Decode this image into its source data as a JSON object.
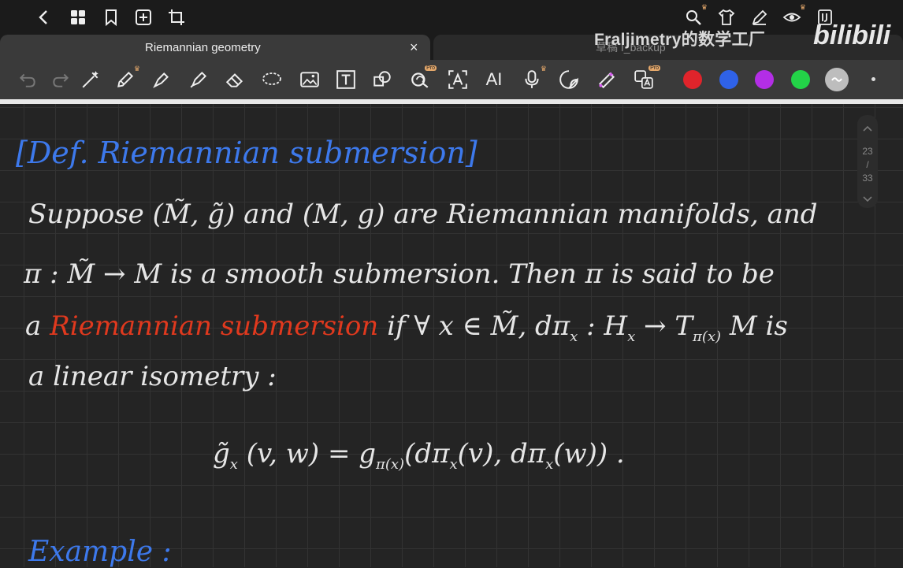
{
  "tabs": {
    "active_title": "Riemannian geometry",
    "close_glyph": "×",
    "inactive_title": "草稿 I_backup"
  },
  "watermark": {
    "text": "Fraljimetry的数学工厂",
    "brand": "bilibili"
  },
  "toolbar": {
    "ai_label": "AI",
    "pro_badge": "Pro",
    "colors": [
      "#e0242b",
      "#2f62e8",
      "#b32ee6",
      "#23d348",
      "#bdbdbd"
    ]
  },
  "page_indicator": {
    "current": "23",
    "separator": "/",
    "total": "33"
  },
  "note": {
    "heading": "[Def. Riemannian submersion]",
    "line1": "Suppose (M̃, g̃) and (M, g) are Riemannian manifolds, and",
    "line2": "π : M̃ → M is a smooth submersion. Then π is said to be",
    "line3_a": "a",
    "line3_red": "Riemannian submersion",
    "line3_b": "if ∀ x ∈ M̃, dπ",
    "line3_sub1": "x",
    "line3_c": ": H",
    "line3_sub2": "x",
    "line3_d": "→ T",
    "line3_sub3": "π(x)",
    "line3_e": "M is",
    "line4": "a linear isometry :",
    "formula_a": "g̃",
    "formula_sub_a": "x",
    "formula_b": "(v, w) = g",
    "formula_sub_b": "π(x)",
    "formula_c": "(dπ",
    "formula_sub_c": "x",
    "formula_d": "(v), dπ",
    "formula_sub_d": "x",
    "formula_e": "(w)) .",
    "example": "Example :"
  }
}
